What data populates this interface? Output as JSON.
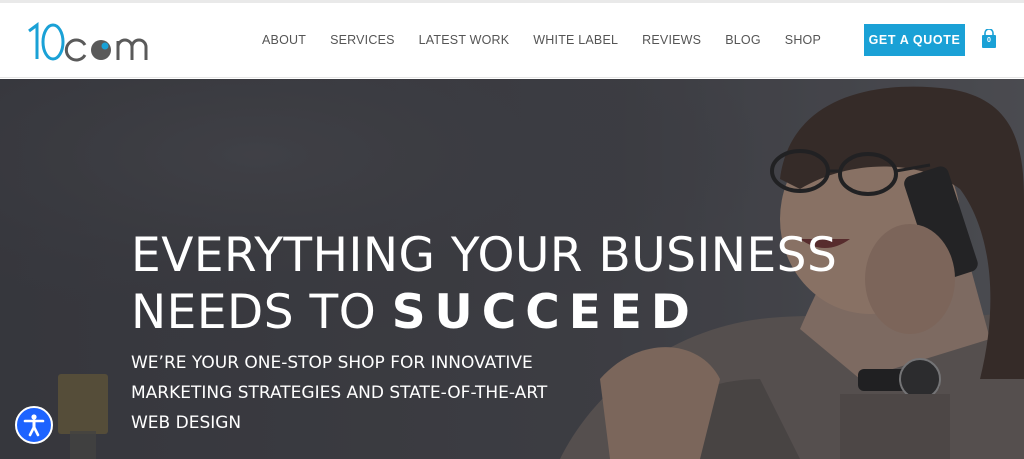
{
  "brand": {
    "logo_text": "10com",
    "accent": "#1aa1d6"
  },
  "nav": {
    "items": [
      {
        "label": "ABOUT"
      },
      {
        "label": "SERVICES"
      },
      {
        "label": "LATEST WORK"
      },
      {
        "label": "WHITE LABEL"
      },
      {
        "label": "REVIEWS"
      },
      {
        "label": "BLOG"
      },
      {
        "label": "SHOP"
      }
    ]
  },
  "cta": {
    "label": "GET A QUOTE",
    "color": "#1aa1d6"
  },
  "cart": {
    "count": "0",
    "icon": "shopping-bag-icon"
  },
  "hero": {
    "heading_line1": "EVERYTHING YOUR BUSINESS",
    "heading_line2_plain": "NEEDS TO",
    "heading_line2_strong": "SUCCEED",
    "subheading": "WE’RE YOUR ONE-STOP SHOP FOR INNOVATIVE MARKETING STRATEGIES AND STATE-OF-THE-ART WEB DESIGN",
    "background": "photo-woman-on-phone"
  },
  "accessibility": {
    "icon": "accessibility-icon",
    "color": "#1d63ff"
  }
}
